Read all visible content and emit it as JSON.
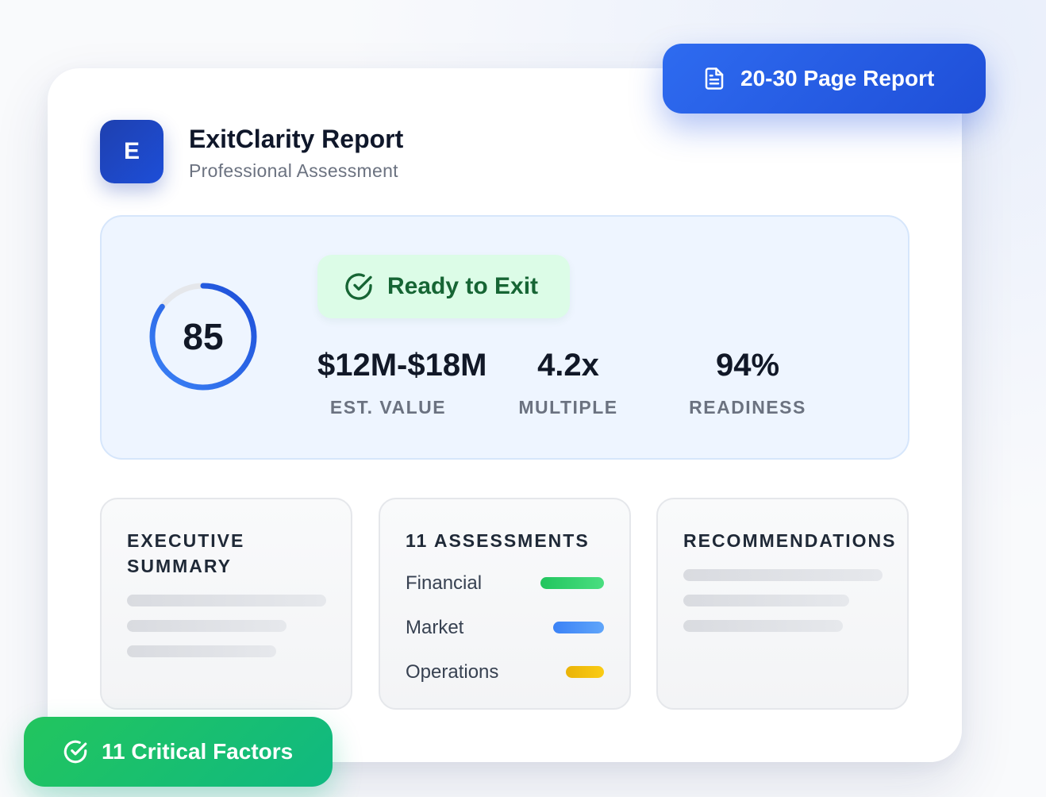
{
  "report_badge": {
    "label": "20-30 Page Report",
    "icon": "document-icon"
  },
  "factors_badge": {
    "label": "11 Critical Factors",
    "icon": "check-circle-icon"
  },
  "header": {
    "logo_letter": "E",
    "title": "ExitClarity Report",
    "subtitle": "Professional Assessment"
  },
  "score": {
    "value": "85",
    "status": "Ready to Exit",
    "status_icon": "check-circle-icon",
    "progress_fraction": 0.85
  },
  "metrics": [
    {
      "value": "$12M-$18M",
      "label": "EST. VALUE"
    },
    {
      "value": "4.2x",
      "label": "MULTIPLE"
    },
    {
      "value": "94%",
      "label": "READINESS"
    }
  ],
  "sections": {
    "executive_summary": {
      "title_line1": "EXECUTIVE",
      "title_line2": "SUMMARY"
    },
    "assessments": {
      "title": "11 ASSESSMENTS",
      "items": [
        {
          "label": "Financial",
          "color": "#22c55e"
        },
        {
          "label": "Market",
          "color": "#3b82f6"
        },
        {
          "label": "Operations",
          "color": "#eab308"
        }
      ]
    },
    "recommendations": {
      "title": "RECOMMENDATIONS"
    }
  },
  "colors": {
    "primary": "#2563eb",
    "success": "#22c55e",
    "status_bg": "#dcfce7",
    "status_text": "#166534"
  }
}
